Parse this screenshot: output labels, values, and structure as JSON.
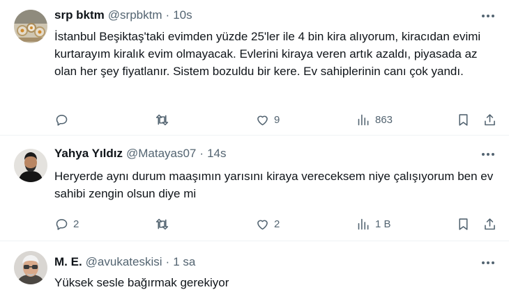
{
  "tweets": [
    {
      "name": "srp bktm",
      "handle": "@srpbktm",
      "separator": "·",
      "time": "10s",
      "text": "İstanbul Beşiktaş'taki evimden yüzde 25'ler ile 4 bin kira alıyorum, kiracıdan evimi kurtarayım kiralık evim olmayacak. Evlerini kiraya veren artık azaldı, piyasada az olan her şey fiyatlanır. Sistem bozuldu bir kere. Ev sahiplerinin canı çok yandı.",
      "replies": "",
      "retweets": "",
      "likes": "9",
      "views": "863"
    },
    {
      "name": "Yahya Yıldız",
      "handle": "@Matayas07",
      "separator": "·",
      "time": "14s",
      "text": "Heryerde aynı durum maaşımın yarısını kiraya vereceksem niye çalışıyorum ben ev sahibi zengin olsun diye mi",
      "replies": "2",
      "retweets": "",
      "likes": "2",
      "views": "1 B"
    },
    {
      "name": "M. E.",
      "handle": "@avukateskisi",
      "separator": "·",
      "time": "1 sa",
      "text": "Yüksek sesle bağırmak gerekiyor"
    }
  ],
  "icons": {
    "reply": "reply-icon",
    "retweet": "retweet-icon",
    "like": "heart-icon",
    "views": "views-icon",
    "bookmark": "bookmark-icon",
    "share": "share-icon",
    "more": "more-icon"
  },
  "colors": {
    "text": "#0f1419",
    "secondary": "#536471",
    "divider": "#eff3f4"
  }
}
